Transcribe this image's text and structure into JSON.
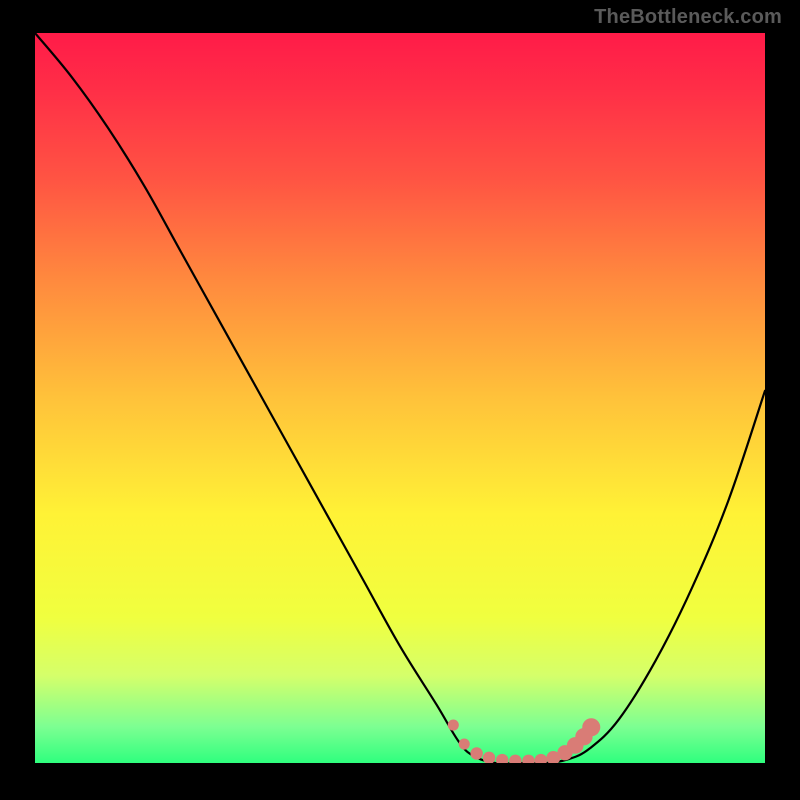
{
  "attribution": "TheBottleneck.com",
  "colors": {
    "page_bg": "#000000",
    "curve_stroke": "#000000",
    "marker_fill": "#d97c76",
    "gradient_stops": [
      "#ff1b48",
      "#ff2f47",
      "#ff5443",
      "#ff8a3e",
      "#ffc23a",
      "#fff236",
      "#f0ff3f",
      "#d5ff6a",
      "#7dff92",
      "#2fff7e"
    ]
  },
  "chart_data": {
    "type": "line",
    "title": "",
    "xlabel": "",
    "ylabel": "",
    "xlim": [
      0,
      100
    ],
    "ylim": [
      0,
      100
    ],
    "grid": false,
    "legend": false,
    "annotations": [],
    "series": [
      {
        "name": "curve",
        "x": [
          0,
          5,
          10,
          15,
          20,
          25,
          30,
          35,
          40,
          45,
          50,
          55,
          58,
          60,
          63,
          67,
          70,
          73,
          76,
          80,
          85,
          90,
          95,
          100
        ],
        "values": [
          100,
          94,
          87,
          79,
          70,
          61,
          52,
          43,
          34,
          25,
          16,
          8,
          3,
          1,
          0,
          0,
          0,
          0.5,
          2,
          6,
          14,
          24,
          36,
          51
        ]
      }
    ],
    "markers": [
      {
        "x": 57.3,
        "y": 5.2,
        "r": 0.8
      },
      {
        "x": 58.8,
        "y": 2.6,
        "r": 0.8
      },
      {
        "x": 60.5,
        "y": 1.3,
        "r": 0.9
      },
      {
        "x": 62.2,
        "y": 0.7,
        "r": 0.9
      },
      {
        "x": 64.0,
        "y": 0.4,
        "r": 0.9
      },
      {
        "x": 65.8,
        "y": 0.3,
        "r": 0.9
      },
      {
        "x": 67.6,
        "y": 0.3,
        "r": 0.9
      },
      {
        "x": 69.3,
        "y": 0.4,
        "r": 0.9
      },
      {
        "x": 71.0,
        "y": 0.7,
        "r": 1.0
      },
      {
        "x": 72.6,
        "y": 1.4,
        "r": 1.1
      },
      {
        "x": 74.0,
        "y": 2.4,
        "r": 1.2
      },
      {
        "x": 75.2,
        "y": 3.6,
        "r": 1.25
      },
      {
        "x": 76.2,
        "y": 4.9,
        "r": 1.3
      }
    ]
  }
}
